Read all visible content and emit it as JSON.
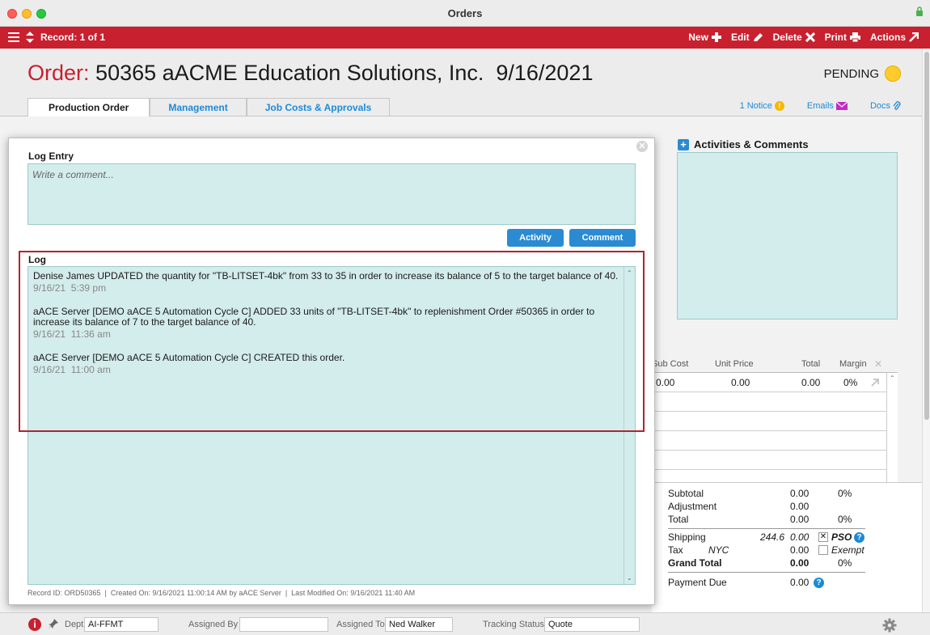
{
  "window": {
    "title": "Orders"
  },
  "toolbar": {
    "record_label": "Record: 1 of 1",
    "new_label": "New",
    "edit_label": "Edit",
    "delete_label": "Delete",
    "print_label": "Print",
    "actions_label": "Actions"
  },
  "header": {
    "title_prefix": "Order:",
    "title_text": "50365 aACME Education Solutions, Inc.  9/16/2021",
    "status": "PENDING",
    "status_color": "#ffcc2a"
  },
  "tabs": [
    {
      "label": "Production Order"
    },
    {
      "label": "Management"
    },
    {
      "label": "Job Costs & Approvals"
    }
  ],
  "header_links": {
    "notice": "1 Notice",
    "emails": "Emails",
    "docs": "Docs"
  },
  "activities": {
    "title": "Activities & Comments"
  },
  "line_items": {
    "columns": [
      "Sub Cost",
      "Unit Price",
      "Total",
      "Margin"
    ],
    "row": {
      "sub_cost": "0.00",
      "unit_price": "0.00",
      "total": "0.00",
      "margin": "0%"
    }
  },
  "totals": {
    "subtotal_label": "Subtotal",
    "subtotal_value": "0.00",
    "subtotal_pct": "0%",
    "adjustment_label": "Adjustment",
    "adjustment_value": "0.00",
    "total_label": "Total",
    "total_value": "0.00",
    "total_pct": "0%",
    "shipping_label": "Shipping",
    "shipping_weight": "244.6",
    "shipping_value": "0.00",
    "pso_label": "PSO",
    "tax_label": "Tax",
    "tax_region": "NYC",
    "tax_value": "0.00",
    "exempt_label": "Exempt",
    "grand_total_label": "Grand Total",
    "grand_total_value": "0.00",
    "grand_total_pct": "0%",
    "payment_due_label": "Payment Due",
    "payment_due_value": "0.00"
  },
  "dialog": {
    "log_entry_label": "Log Entry",
    "comment_placeholder": "Write a comment...",
    "activity_button": "Activity",
    "comment_button": "Comment",
    "log_label": "Log",
    "entries": [
      {
        "text": "Denise James UPDATED the quantity for \"TB-LITSET-4bk\" from 33 to 35 in order to increase its balance of 5 to the target balance of 40.",
        "time": "9/16/21  5:39 pm"
      },
      {
        "text": "aACE Server [DEMO aACE 5 Automation Cycle C] ADDED 33 units of \"TB-LITSET-4bk\" to replenishment Order #50365 in order to increase its balance of 7 to the target balance of 40.",
        "time": "9/16/21  11:36 am"
      },
      {
        "text": "aACE Server [DEMO aACE 5 Automation Cycle C] CREATED this order.",
        "time": "9/16/21  11:00 am"
      }
    ],
    "record_info": "Record ID: ORD50365  |  Created On: 9/16/2021 11:00:14 AM by aACE Server  |  Last Modified On: 9/16/2021 11:40 AM"
  },
  "bottom_bar": {
    "dept_label": "Dept",
    "dept_value": "AI-FFMT",
    "assigned_by_label": "Assigned By",
    "assigned_by_value": "",
    "assigned_to_label": "Assigned To",
    "assigned_to_value": "Ned Walker",
    "tracking_label": "Tracking Status",
    "tracking_value": "Quote"
  }
}
